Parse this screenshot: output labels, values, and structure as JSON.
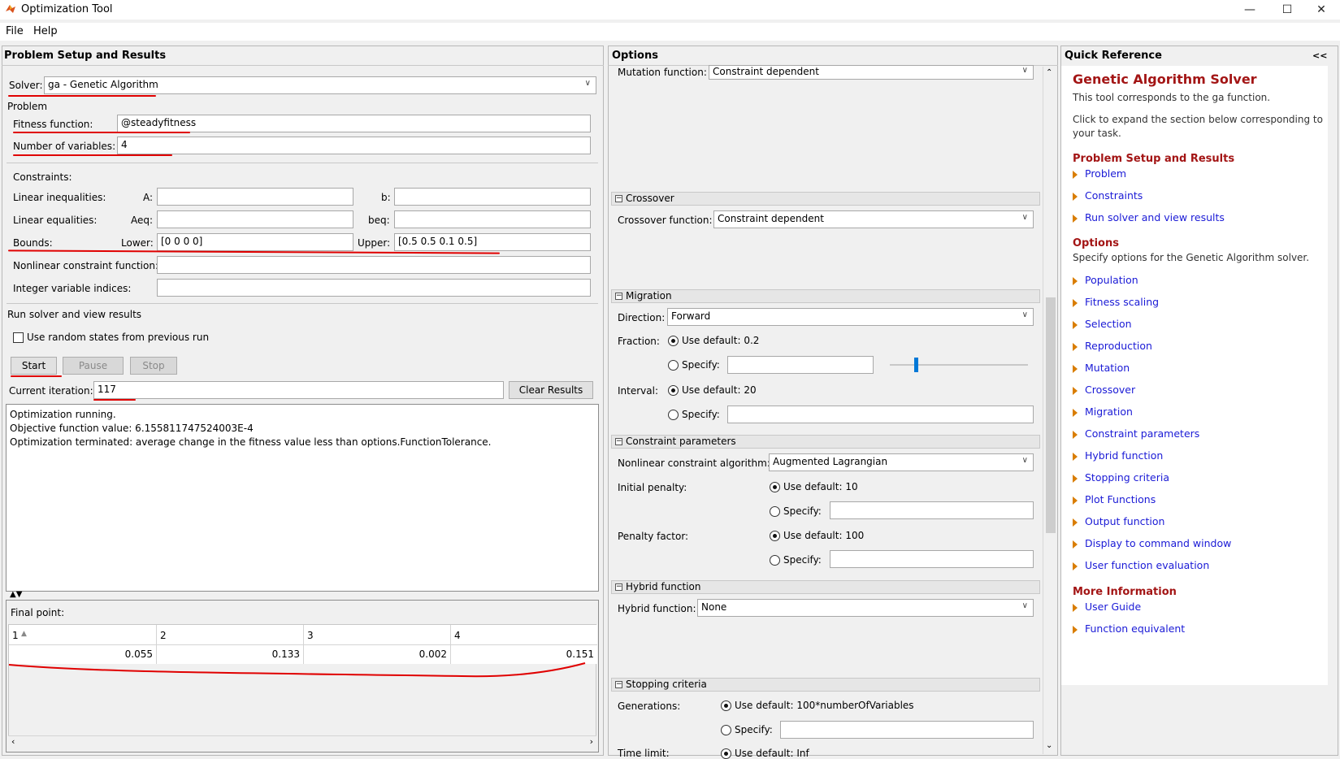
{
  "window": {
    "title": "Optimization Tool"
  },
  "menu": {
    "file": "File",
    "help": "Help"
  },
  "left": {
    "header": "Problem Setup and Results",
    "solver_label": "Solver:",
    "solver_value": "ga - Genetic Algorithm",
    "problem_label": "Problem",
    "fitness_label": "Fitness function:",
    "fitness_value": "@steadyfitness",
    "numvars_label": "Number of variables:",
    "numvars_value": "4",
    "constraints_label": "Constraints:",
    "lin_ineq_label": "Linear inequalities:",
    "a_label": "A:",
    "b_label": "b:",
    "lin_eq_label": "Linear equalities:",
    "aeq_label": "Aeq:",
    "beq_label": "beq:",
    "bounds_label": "Bounds:",
    "lower_label": "Lower:",
    "lower_value": "[0 0 0 0]",
    "upper_label": "Upper:",
    "upper_value": "[0.5 0.5 0.1 0.5]",
    "nonlin_label": "Nonlinear constraint function:",
    "intvar_label": "Integer variable indices:",
    "run_label": "Run solver and view results",
    "random_states_label": "Use random states from previous run",
    "start": "Start",
    "pause": "Pause",
    "stop": "Stop",
    "iter_label": "Current iteration:",
    "iter_value": "117",
    "clear": "Clear Results",
    "output": [
      "Optimization running.",
      "Objective function value: 6.155811747524003E-4",
      "Optimization terminated: average change in the fitness value less than options.FunctionTolerance."
    ],
    "final_point_label": "Final point:",
    "table_headers": [
      "1",
      "2",
      "3",
      "4"
    ],
    "table_values": [
      "0.055",
      "0.133",
      "0.002",
      "0.151"
    ]
  },
  "options": {
    "header": "Options",
    "mutation_label": "Mutation function:",
    "mutation_value": "Constraint dependent",
    "crossover_head": "Crossover",
    "crossover_label": "Crossover function:",
    "crossover_value": "Constraint dependent",
    "migration_head": "Migration",
    "direction_label": "Direction:",
    "direction_value": "Forward",
    "fraction_label": "Fraction:",
    "fraction_default": "Use default: 0.2",
    "specify": "Specify:",
    "interval_label": "Interval:",
    "interval_default": "Use default: 20",
    "constraint_head": "Constraint parameters",
    "nlc_label": "Nonlinear constraint algorithm:",
    "nlc_value": "Augmented Lagrangian",
    "init_pen_label": "Initial penalty:",
    "init_pen_default": "Use default: 10",
    "pen_factor_label": "Penalty factor:",
    "pen_factor_default": "Use default: 100",
    "hybrid_head": "Hybrid function",
    "hybrid_label": "Hybrid function:",
    "hybrid_value": "None",
    "stopping_head": "Stopping criteria",
    "generations_label": "Generations:",
    "generations_default": "Use default: 100*numberOfVariables",
    "timelimit_label": "Time limit:",
    "timelimit_default": "Use default: Inf"
  },
  "quickref": {
    "header": "Quick Reference",
    "collapse": "<<",
    "title": "Genetic Algorithm Solver",
    "line1": "This tool corresponds to the ga function.",
    "line2": "Click to expand the section below corresponding to",
    "line3": "your task.",
    "sec1": "Problem Setup and Results",
    "links1": [
      "Problem",
      "Constraints",
      "Run solver and view results"
    ],
    "sec2": "Options",
    "sec2_desc": "Specify options for the Genetic Algorithm solver.",
    "links2": [
      "Population",
      "Fitness scaling",
      "Selection",
      "Reproduction",
      "Mutation",
      "Crossover",
      "Migration",
      "Constraint parameters",
      "Hybrid function",
      "Stopping criteria",
      "Plot Functions",
      "Output function",
      "Display to command window",
      "User function evaluation"
    ],
    "sec3": "More Information",
    "links3": [
      "User Guide",
      "Function equivalent"
    ]
  },
  "colors": {
    "annotation_red": "#e00000",
    "link_blue": "#1a1ad6",
    "heading_red": "#a31515"
  }
}
